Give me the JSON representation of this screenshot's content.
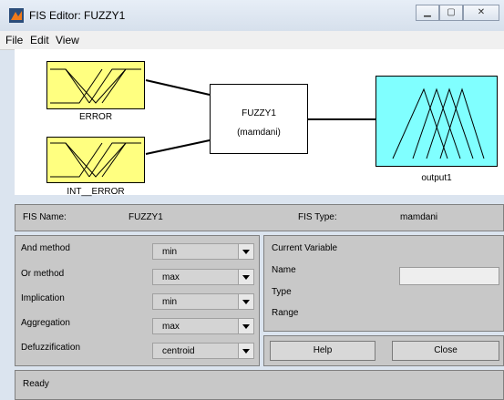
{
  "window": {
    "title": "FIS Editor: FUZZY1",
    "controls": [
      "minimize",
      "maximize",
      "close"
    ]
  },
  "menu": {
    "items": [
      "File",
      "Edit",
      "View"
    ]
  },
  "diagram": {
    "inputs": [
      {
        "label": "ERROR",
        "color": "#ffff80"
      },
      {
        "label": "INT__ERROR",
        "color": "#ffff80"
      }
    ],
    "system": {
      "name": "FUZZY1",
      "type": "(mamdani)"
    },
    "output": {
      "label": "output1",
      "color": "#80ffff"
    }
  },
  "info": {
    "fis_name_label": "FIS Name:",
    "fis_name": "FUZZY1",
    "fis_type_label": "FIS Type:",
    "fis_type": "mamdani"
  },
  "methods": [
    {
      "label": "And method",
      "value": "min"
    },
    {
      "label": "Or method",
      "value": "max"
    },
    {
      "label": "Implication",
      "value": "min"
    },
    {
      "label": "Aggregation",
      "value": "max"
    },
    {
      "label": "Defuzzification",
      "value": "centroid"
    }
  ],
  "current_variable": {
    "title": "Current Variable",
    "name_label": "Name",
    "name_value": "",
    "type_label": "Type",
    "range_label": "Range"
  },
  "buttons": {
    "help": "Help",
    "close": "Close"
  },
  "status": {
    "text": "Ready"
  }
}
